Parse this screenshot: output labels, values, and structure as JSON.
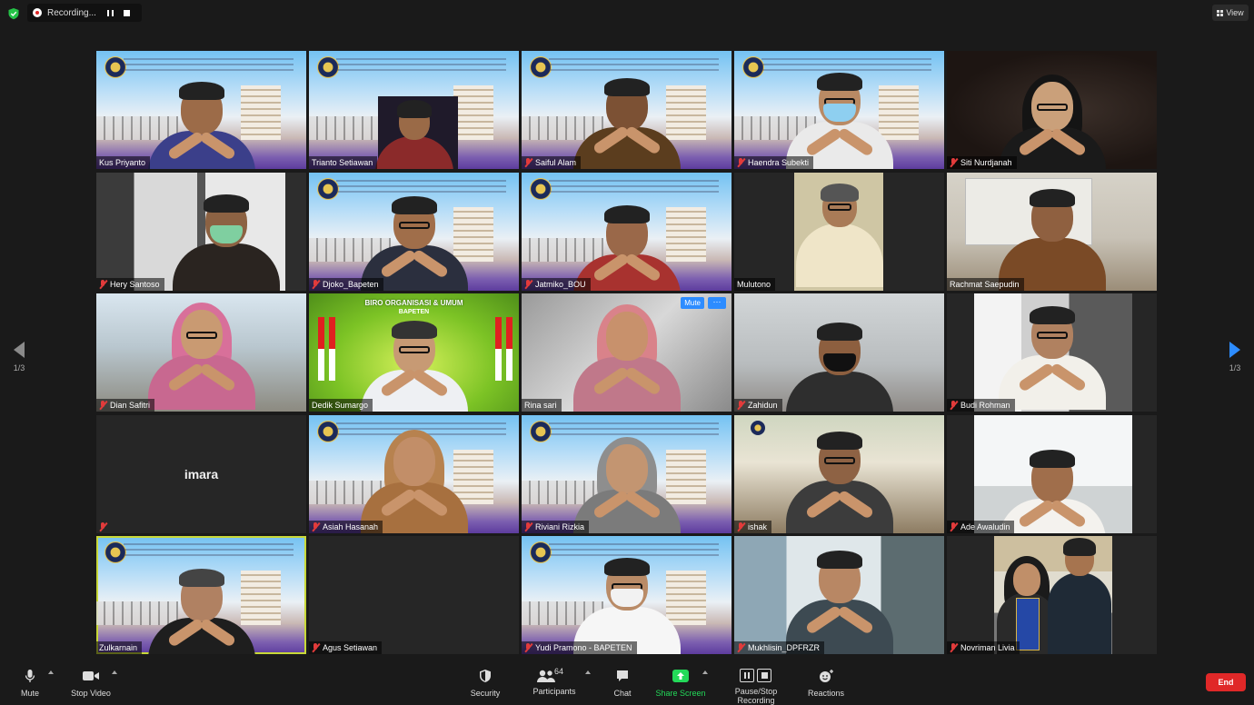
{
  "top": {
    "recording_label": "Recording...",
    "view_label": "View"
  },
  "nav": {
    "page_left": "1/3",
    "page_right": "1/3"
  },
  "tiles": [
    {
      "name": "Kus Priyanto",
      "muted": false
    },
    {
      "name": "Trianto Setiawan",
      "muted": false
    },
    {
      "name": "Saiful Alam",
      "muted": true
    },
    {
      "name": "Haendra Subekti",
      "muted": true
    },
    {
      "name": "Siti Nurdjanah",
      "muted": true
    },
    {
      "name": "Hery Santoso",
      "muted": true
    },
    {
      "name": "Djoko_Bapeten",
      "muted": true
    },
    {
      "name": "Jatmiko_BOU",
      "muted": true
    },
    {
      "name": "Mulutono",
      "muted": false
    },
    {
      "name": "Rachmat Saepudin",
      "muted": false
    },
    {
      "name": "Dian Safitri",
      "muted": true
    },
    {
      "name": "Dedik Sumargo",
      "muted": false
    },
    {
      "name": "Rina sari",
      "muted": false
    },
    {
      "name": "Zahidun",
      "muted": true
    },
    {
      "name": "Budi Rohman",
      "muted": true
    },
    {
      "name": "imara",
      "muted": true
    },
    {
      "name": "Asiah Hasanah",
      "muted": true
    },
    {
      "name": "Riviani Rizkia",
      "muted": true
    },
    {
      "name": "ishak",
      "muted": true
    },
    {
      "name": "Ade Awaludin",
      "muted": true
    },
    {
      "name": "Zulkarnain",
      "muted": false
    },
    {
      "name": "Agus Setiawan",
      "muted": true
    },
    {
      "name": "Yudi Pramono - BAPETEN",
      "muted": true
    },
    {
      "name": "Mukhlisin_DPFRZR",
      "muted": true
    },
    {
      "name": "Novriman Livia",
      "muted": true
    }
  ],
  "tile_controls": {
    "mute_label": "Mute",
    "more_label": "···"
  },
  "green_banner": {
    "title": "BIRO ORGANISASI & UMUM",
    "subtitle": "BAPETEN"
  },
  "toolbar": {
    "mute": "Mute",
    "stop_video": "Stop Video",
    "security": "Security",
    "participants": "Participants",
    "participants_count": "64",
    "chat": "Chat",
    "share_screen": "Share Screen",
    "recording": "Pause/Stop Recording",
    "reactions": "Reactions",
    "end": "End"
  },
  "colors": {
    "accent": "#2d8cff",
    "share": "#23d959",
    "end": "#e02828",
    "muted_icon": "#e23b3b",
    "active_speaker": "#c8d838"
  }
}
